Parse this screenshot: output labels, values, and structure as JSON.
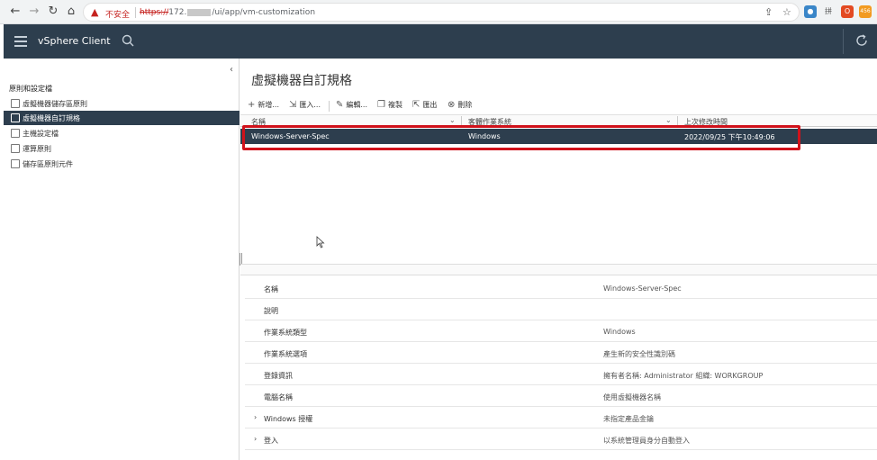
{
  "browser": {
    "insecure_label": "不安全",
    "url_scheme": "https://",
    "url_host": "172.",
    "url_path": "/ui/app/vm-customization",
    "ext_badge": "456"
  },
  "header": {
    "title": "vSphere Client"
  },
  "sidebar": {
    "section_title": "原則和設定檔",
    "items": [
      {
        "label": "虛擬機器儲存區原則",
        "active": false
      },
      {
        "label": "虛擬機器自訂規格",
        "active": true
      },
      {
        "label": "主機設定檔",
        "active": false
      },
      {
        "label": "運算原則",
        "active": false
      },
      {
        "label": "儲存區原則元件",
        "active": false
      }
    ]
  },
  "main": {
    "title": "虛擬機器自訂規格",
    "toolbar": {
      "new_label": "新增...",
      "import_label": "匯入...",
      "edit_label": "編輯...",
      "copy_label": "複製",
      "export_label": "匯出",
      "delete_label": "刪除"
    },
    "columns": [
      "名稱",
      "客體作業系統",
      "上次修改時間"
    ],
    "rows": [
      {
        "name": "Windows-Server-Spec",
        "os": "Windows",
        "modified": "2022/09/25 下午10:49:06"
      }
    ],
    "details": [
      {
        "label": "名稱",
        "value": "Windows-Server-Spec",
        "expandable": false
      },
      {
        "label": "說明",
        "value": "",
        "expandable": false
      },
      {
        "label": "作業系統類型",
        "value": "Windows",
        "expandable": false
      },
      {
        "label": "作業系統選項",
        "value": "產生新的安全性識別碼",
        "expandable": false
      },
      {
        "label": "登錄資訊",
        "value": "擁有者名稱: Administrator 組織: WORKGROUP",
        "expandable": false
      },
      {
        "label": "電腦名稱",
        "value": "使用虛擬機器名稱",
        "expandable": false
      },
      {
        "label": "Windows 授權",
        "value": "未指定產品金鑰",
        "expandable": true
      },
      {
        "label": "登入",
        "value": "以系統管理員身分自動登入",
        "expandable": true
      }
    ]
  },
  "colors": {
    "header_bg": "#2d3e4e",
    "selection_bg": "#2d3e4e",
    "highlight_border": "#d0121b"
  }
}
